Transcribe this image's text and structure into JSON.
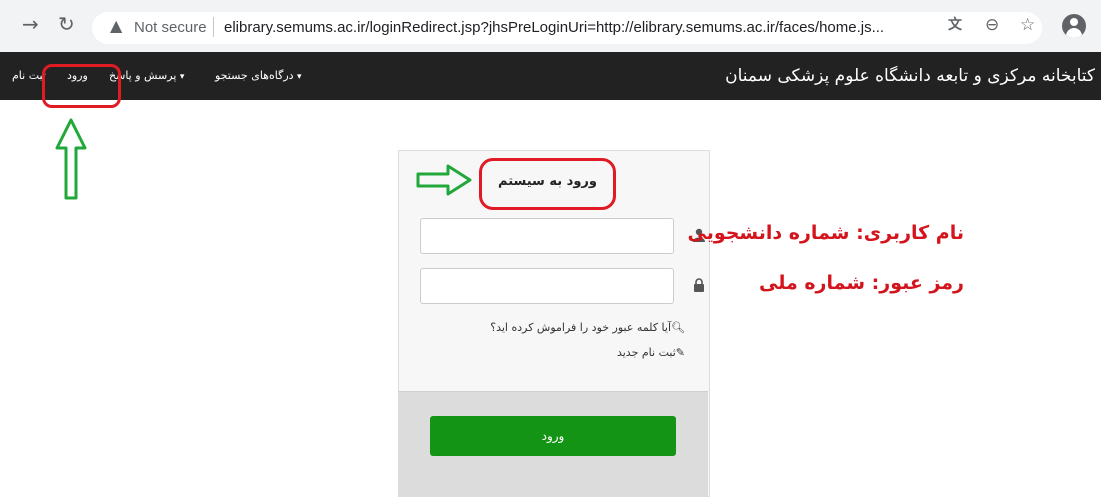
{
  "browser": {
    "back_icon": "arrow-right-icon",
    "reload_icon": "reload-icon",
    "security_warning_icon": "warning-triangle-icon",
    "security_label": "Not secure",
    "url": "elibrary.semums.ac.ir/loginRedirect.jsp?jhsPreLoginUri=http://elibrary.semums.ac.ir/faces/home.js...",
    "toolbar_icons": [
      "translate-icon",
      "zoom-icon",
      "star-icon",
      "profile-icon"
    ]
  },
  "nav": {
    "brand": "کتابخانه مرکزی و تابعه دانشگاه علوم پزشکی سمنان",
    "portals": "درگاه‌های جستجو",
    "faq": "پرسش و پاسخ",
    "login": "ورود",
    "register": "ثبت نام",
    "caret": "▾"
  },
  "login_panel": {
    "title": "ورود به سیستم",
    "username_icon": "user-icon",
    "password_icon": "lock-icon",
    "forgot_link": "آیا کلمه عبور خود را فراموش کرده اید؟",
    "register_link": "ثبت نام جدید",
    "submit_label": "ورود"
  },
  "annotations": {
    "username_hint": "نام کاربری: شماره دانشجویی",
    "password_hint": "رمز عبور: شماره ملی",
    "accent": "#e01b24",
    "arrow_color": "#22a83a"
  }
}
